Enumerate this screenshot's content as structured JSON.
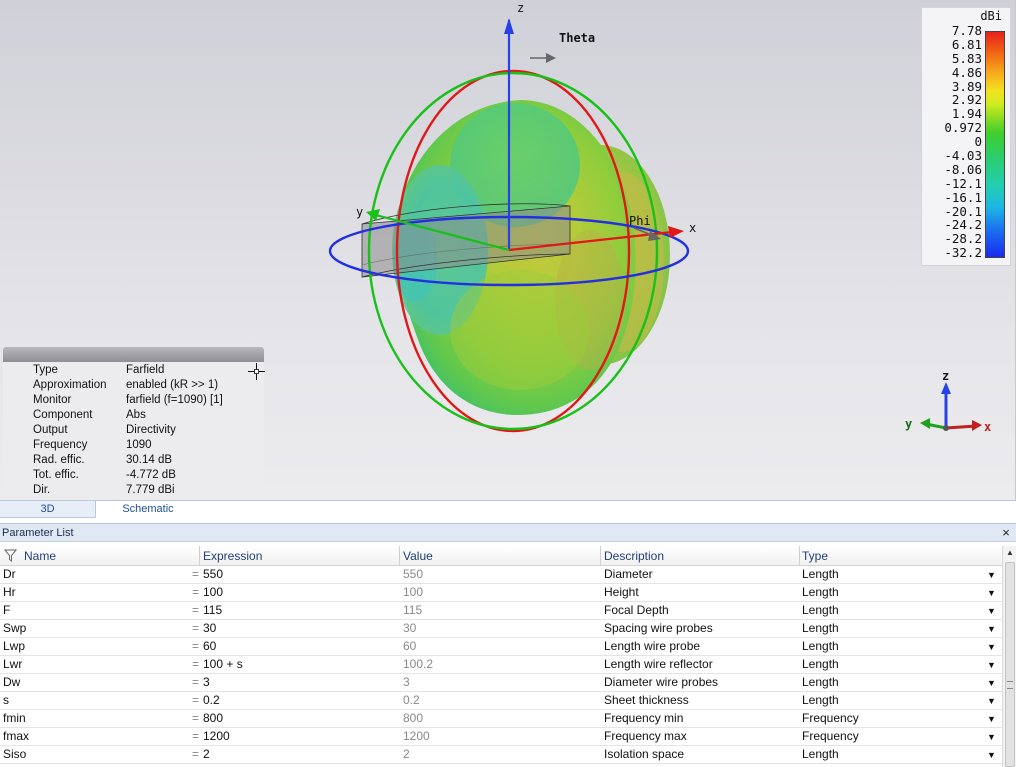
{
  "viewport": {
    "axis_labels": {
      "z": "z",
      "theta": "Theta",
      "y": "y",
      "phi": "Phi",
      "x": "x"
    },
    "legend": {
      "unit": "dBi",
      "ticks": [
        "7.78",
        "6.81",
        "5.83",
        "4.86",
        "3.89",
        "2.92",
        "1.94",
        "0.972",
        "0",
        "-4.03",
        "-8.06",
        "-12.1",
        "-16.1",
        "-20.1",
        "-24.2",
        "-28.2",
        "-32.2"
      ],
      "colors": {
        "max": "#e8201c",
        "mid": "#3fce2c",
        "min": "#1a2af0"
      }
    },
    "triad_labels": {
      "z": "z",
      "y": "y",
      "x": "x"
    }
  },
  "info": {
    "rows": [
      {
        "key": "Type",
        "value": "Farfield"
      },
      {
        "key": "Approximation",
        "value": "enabled (kR >> 1)"
      },
      {
        "key": "Monitor",
        "value": "farfield (f=1090) [1]"
      },
      {
        "key": "Component",
        "value": "Abs"
      },
      {
        "key": "Output",
        "value": "Directivity"
      },
      {
        "key": "Frequency",
        "value": "1090"
      },
      {
        "key": "Rad. effic.",
        "value": "30.14 dB"
      },
      {
        "key": "Tot. effic.",
        "value": "-4.772 dB"
      },
      {
        "key": "Dir.",
        "value": "7.779 dBi"
      }
    ]
  },
  "view_tabs": {
    "tab_3d": "3D",
    "tab_schematic": "Schematic"
  },
  "parameter_list": {
    "title": "Parameter List",
    "close": "×",
    "columns": {
      "name": "Name",
      "expression": "Expression",
      "value": "Value",
      "description": "Description",
      "type": "Type"
    },
    "rows": [
      {
        "name": "Dr",
        "expression": "550",
        "value": "550",
        "description": "Diameter",
        "type": "Length"
      },
      {
        "name": "Hr",
        "expression": "100",
        "value": "100",
        "description": "Height",
        "type": "Length"
      },
      {
        "name": "F",
        "expression": "115",
        "value": "115",
        "description": "Focal Depth",
        "type": "Length"
      },
      {
        "name": "Swp",
        "expression": "30",
        "value": "30",
        "description": "Spacing wire probes",
        "type": "Length"
      },
      {
        "name": "Lwp",
        "expression": "60",
        "value": "60",
        "description": "Length wire probe",
        "type": "Length"
      },
      {
        "name": "Lwr",
        "expression": "100 + s",
        "value": "100.2",
        "description": "Length wire reflector",
        "type": "Length"
      },
      {
        "name": "Dw",
        "expression": "3",
        "value": "3",
        "description": "Diameter wire probes",
        "type": "Length"
      },
      {
        "name": "s",
        "expression": "0.2",
        "value": "0.2",
        "description": "Sheet thickness",
        "type": "Length"
      },
      {
        "name": "fmin",
        "expression": "800",
        "value": "800",
        "description": "Frequency min",
        "type": "Frequency"
      },
      {
        "name": "fmax",
        "expression": "1200",
        "value": "1200",
        "description": "Frequency max",
        "type": "Frequency"
      },
      {
        "name": "Siso",
        "expression": "2",
        "value": "2",
        "description": "Isolation space",
        "type": "Length"
      }
    ]
  }
}
